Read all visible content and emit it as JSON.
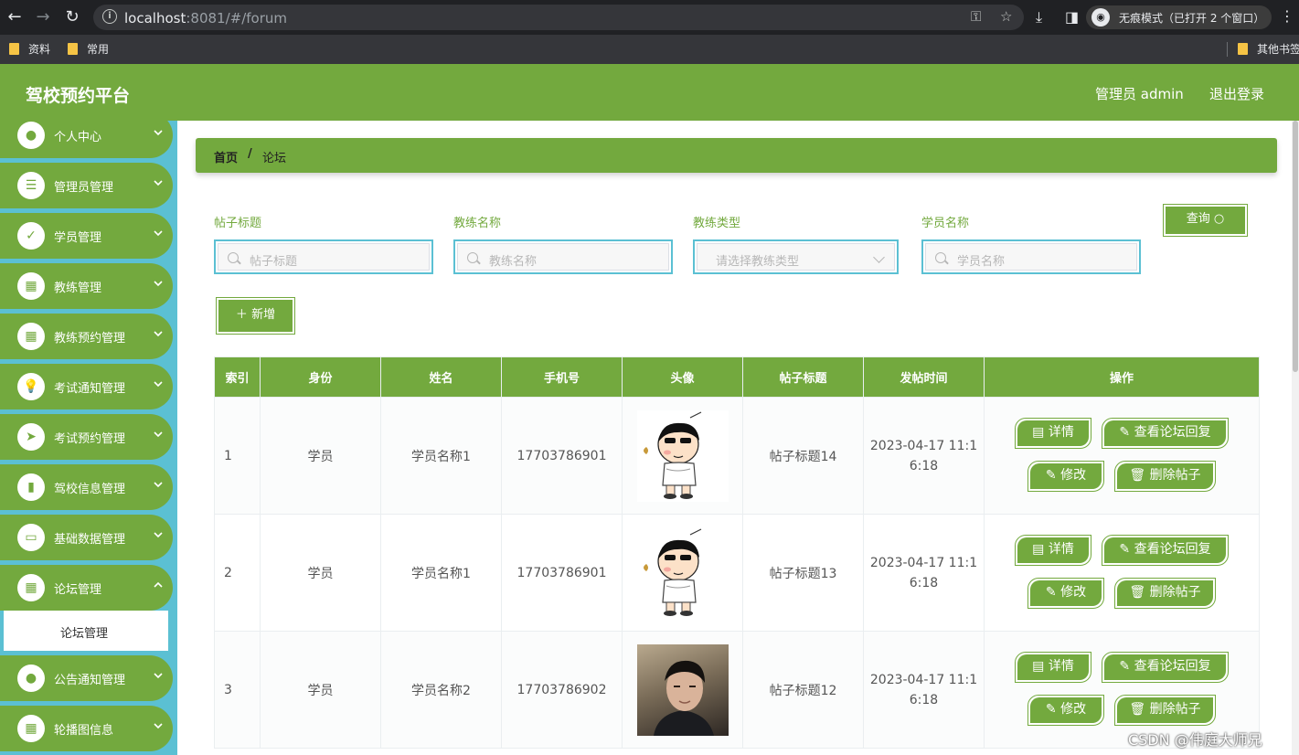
{
  "browser": {
    "url_host": "localhost",
    "url_rest": ":8081/#/forum",
    "incognito_label": "无痕模式（已打开 2 个窗口）",
    "bookmarks": [
      "资料",
      "常用"
    ],
    "other_bookmarks": "其他书签"
  },
  "header": {
    "title": "驾校预约平台",
    "user": "管理员 admin",
    "logout": "退出登录"
  },
  "sidebar": {
    "items": [
      {
        "label": "个人中心",
        "icon": "user-icon"
      },
      {
        "label": "管理员管理",
        "icon": "list-icon"
      },
      {
        "label": "学员管理",
        "icon": "clipboard-icon"
      },
      {
        "label": "教练管理",
        "icon": "grid-icon"
      },
      {
        "label": "教练预约管理",
        "icon": "grid-icon"
      },
      {
        "label": "考试通知管理",
        "icon": "bulb-icon"
      },
      {
        "label": "考试预约管理",
        "icon": "send-icon"
      },
      {
        "label": "驾校信息管理",
        "icon": "bar-chart-icon"
      },
      {
        "label": "基础数据管理",
        "icon": "monitor-icon"
      },
      {
        "label": "论坛管理",
        "icon": "grid-icon"
      },
      {
        "label": "公告通知管理",
        "icon": "user-icon"
      },
      {
        "label": "轮播图信息",
        "icon": "grid-icon"
      }
    ],
    "active_sub": "论坛管理"
  },
  "breadcrumb": {
    "home": "首页",
    "sep": "/",
    "current": "论坛"
  },
  "filters": {
    "title_label": "帖子标题",
    "title_placeholder": "帖子标题",
    "coach_label": "教练名称",
    "coach_placeholder": "教练名称",
    "type_label": "教练类型",
    "type_placeholder": "请选择教练类型",
    "student_label": "学员名称",
    "student_placeholder": "学员名称",
    "query_button": "查询",
    "add_button": "新增"
  },
  "table": {
    "headers": [
      "索引",
      "身份",
      "姓名",
      "手机号",
      "头像",
      "帖子标题",
      "发帖时间",
      "操作"
    ],
    "rows": [
      {
        "index": "1",
        "role": "学员",
        "name": "学员名称1",
        "phone": "17703786901",
        "avatar": "cartoon",
        "title": "帖子标题14",
        "time1": "2023-04-17 11:1",
        "time2": "6:18"
      },
      {
        "index": "2",
        "role": "学员",
        "name": "学员名称1",
        "phone": "17703786901",
        "avatar": "cartoon",
        "title": "帖子标题13",
        "time1": "2023-04-17 11:1",
        "time2": "6:18"
      },
      {
        "index": "3",
        "role": "学员",
        "name": "学员名称2",
        "phone": "17703786902",
        "avatar": "photo",
        "title": "帖子标题12",
        "time1": "2023-04-17 11:1",
        "time2": "6:18"
      }
    ],
    "actions": {
      "detail": "详情",
      "replies": "查看论坛回复",
      "edit": "修改",
      "delete": "删除帖子"
    }
  },
  "watermark": "CSDN @伟庭大师兄",
  "colors": {
    "primary": "#73a93e",
    "sidebar": "#5bc0d3"
  }
}
